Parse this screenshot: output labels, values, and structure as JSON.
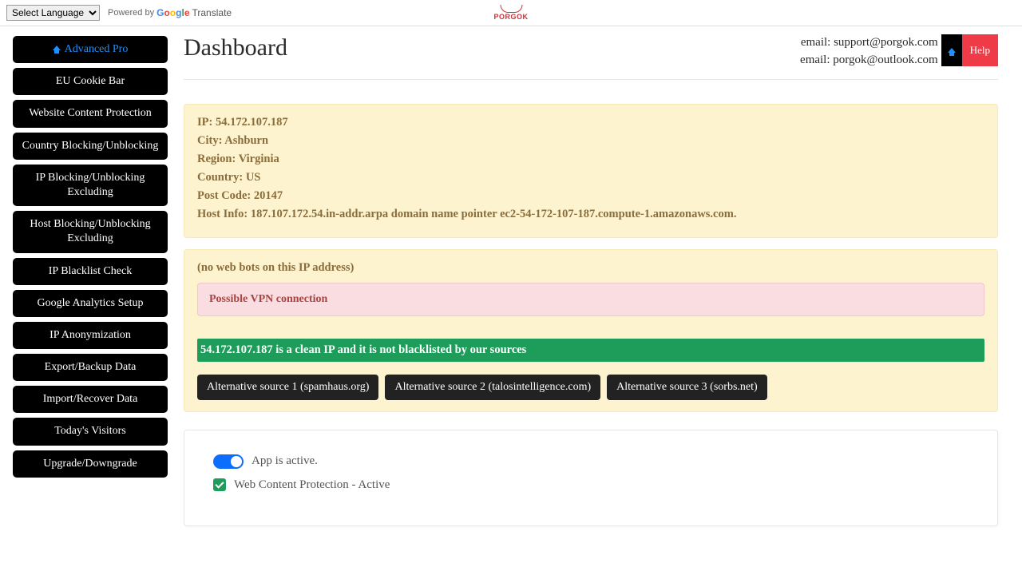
{
  "topbar": {
    "lang_placeholder": "Select Language",
    "powered_by": "Powered by",
    "translate_word": "Translate",
    "brand": "PORGOK"
  },
  "sidebar": {
    "items": [
      "Advanced Pro",
      "EU Cookie Bar",
      "Website Content Protection",
      "Country Blocking/Unblocking",
      "IP Blocking/Unblocking Excluding",
      "Host Blocking/Unblocking Excluding",
      "IP Blacklist Check",
      "Google Analytics Setup",
      "IP Anonymization",
      "Export/Backup Data",
      "Import/Recover Data",
      "Today's Visitors",
      "Upgrade/Downgrade"
    ]
  },
  "header": {
    "title": "Dashboard",
    "email1": "email: support@porgok.com",
    "email2": "email: porgok@outlook.com",
    "help": "Help"
  },
  "ipinfo": {
    "ip_lbl": "IP: ",
    "ip_val": "54.172.107.187",
    "city_lbl": "City: ",
    "city_val": "Ashburn",
    "region_lbl": "Region: ",
    "region_val": "Virginia",
    "country_lbl": "Country: ",
    "country_val": "US",
    "post_lbl": "Post Code: ",
    "post_val": "20147",
    "host_lbl": "Host Info: ",
    "host_val": "187.107.172.54.in-addr.arpa domain name pointer ec2-54-172-107-187.compute-1.amazonaws.com."
  },
  "bots": {
    "none": "(no web bots on this IP address)",
    "vpn": "Possible VPN connection",
    "clean": "54.172.107.187 is a clean IP and it is not blacklisted by our sources",
    "src1": "Alternative source 1 (spamhaus.org)",
    "src2": "Alternative source 2 (talosintelligence.com)",
    "src3": "Alternative source 3 (sorbs.net)"
  },
  "status": {
    "active": "App is active.",
    "wcp": "Web Content Protection - Active"
  }
}
